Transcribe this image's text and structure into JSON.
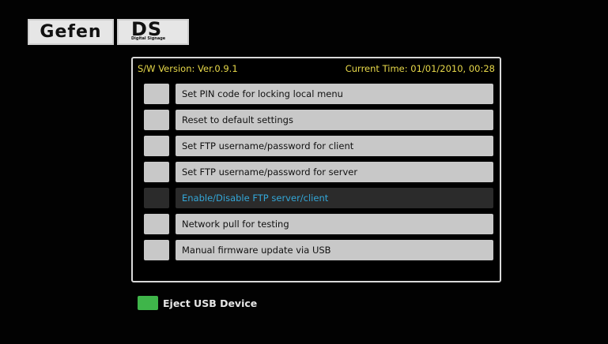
{
  "logo": {
    "brand": "Gefen",
    "product": "DS",
    "product_sub": "Digital Signage"
  },
  "header": {
    "version": "S/W Version: Ver.0.9.1",
    "time": "Current Time: 01/01/2010, 00:28"
  },
  "menu": {
    "selected_index": 4,
    "items": [
      {
        "label": "Set PIN code for locking local menu"
      },
      {
        "label": "Reset to default settings"
      },
      {
        "label": "Set FTP username/password for client"
      },
      {
        "label": "Set FTP username/password for server"
      },
      {
        "label": "Enable/Disable FTP server/client"
      },
      {
        "label": "Network pull for testing"
      },
      {
        "label": "Manual firmware update via USB"
      }
    ]
  },
  "footer": {
    "eject_key_color": "#3fb54a",
    "eject_label": "Eject USB Device"
  },
  "colors": {
    "header_text": "#e8d94a",
    "selected_text": "#33a7d8",
    "item_bg": "#c8c8c8",
    "selected_bg": "#2b2b2b"
  }
}
